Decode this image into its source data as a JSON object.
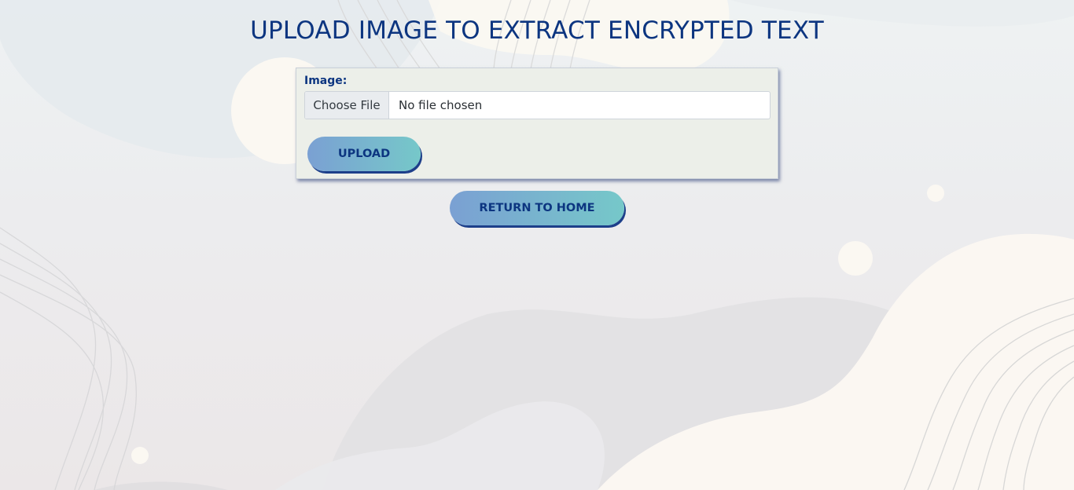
{
  "page": {
    "title": "UPLOAD IMAGE TO EXTRACT ENCRYPTED TEXT"
  },
  "form": {
    "image_label": "Image:",
    "choose_file_label": "Choose File",
    "file_status": "No file chosen",
    "upload_label": "UPLOAD"
  },
  "nav": {
    "return_home_label": "RETURN TO HOME"
  },
  "colors": {
    "title": "#0c3580",
    "button_gradient_start": "#7aa0d3",
    "button_gradient_end": "#76c8c9",
    "card_background": "#ecefe9"
  }
}
